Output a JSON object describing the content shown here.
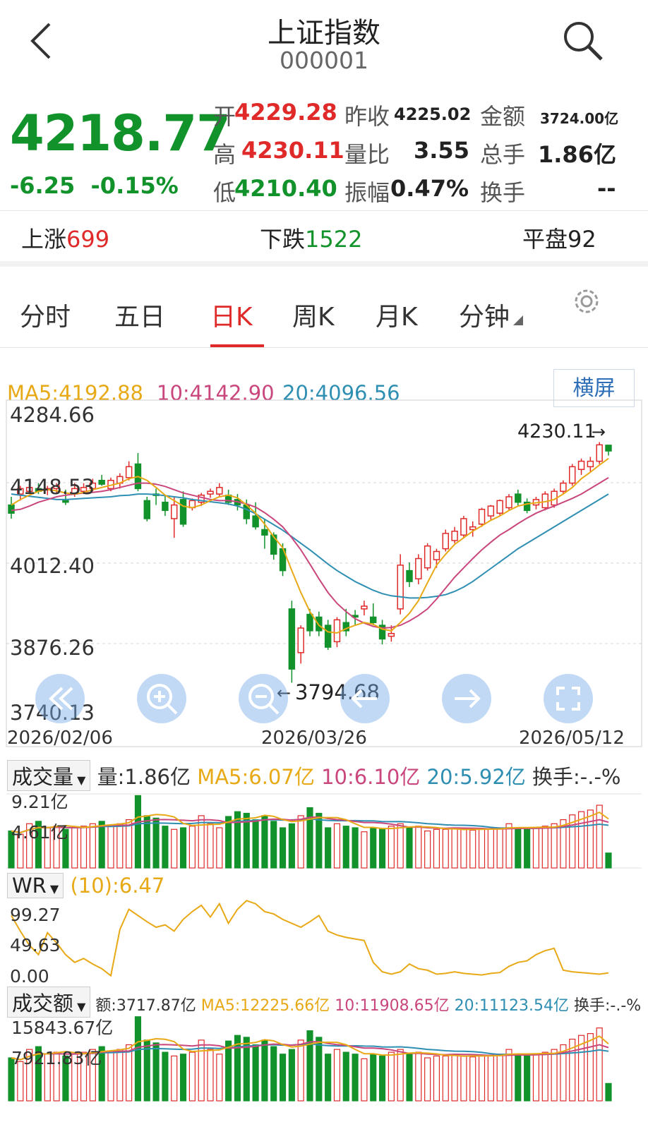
{
  "header": {
    "title": "上证指数",
    "code": "000001"
  },
  "quote": {
    "price": "4218.77",
    "change": "-6.25",
    "change_pct": "-0.15%",
    "open_label": "开",
    "open": "4229.28",
    "prev_close_label": "昨收",
    "prev_close": "4225.02",
    "amount_label": "金额",
    "amount": "3724.00亿",
    "high_label": "高",
    "high": "4230.11",
    "vol_ratio_label": "量比",
    "vol_ratio": "3.55",
    "total_vol_label": "总手",
    "total_vol": "1.86亿",
    "low_label": "低",
    "low": "4210.40",
    "amplitude_label": "振幅",
    "amplitude": "0.47%",
    "turnover_label": "换手",
    "turnover": "--"
  },
  "breadth": {
    "up_label": "上涨",
    "up": "699",
    "down_label": "下跌",
    "down": "1522",
    "flat_label": "平盘",
    "flat": "92"
  },
  "tabs": [
    "分时",
    "五日",
    "日K",
    "周K",
    "月K",
    "分钟"
  ],
  "active_tab": "日K",
  "ma": {
    "ma5": "MA5:4192.88",
    "ma10": "10:4142.90",
    "ma20": "20:4096.56"
  },
  "landscape_label": "横屏",
  "price_axis": [
    "4284.66",
    "4148.53",
    "4012.40",
    "3876.26",
    "3740.13"
  ],
  "annotations": {
    "high_mark": "4230.11",
    "low_mark": "3794.68"
  },
  "dates": [
    "2026/02/06",
    "2026/03/26",
    "2026/05/12"
  ],
  "volume": {
    "selector": "成交量",
    "value": "量:1.86亿",
    "ma5": "MA5:6.07亿",
    "ma10": "10:6.10亿",
    "ma20": "20:5.92亿",
    "turnover": "换手:-.-%",
    "axis": [
      "9.21亿",
      "4.61亿"
    ]
  },
  "wr": {
    "selector": "WR",
    "value": "(10):6.47",
    "axis": [
      "99.27",
      "49.63",
      "0.00"
    ]
  },
  "amount_panel": {
    "selector": "成交额",
    "value": "额:3717.87亿",
    "ma5": "MA5:12225.66亿",
    "ma10": "10:11908.65亿",
    "ma20": "20:11123.54亿",
    "turnover": "换手:-.-%",
    "axis": [
      "15843.67亿",
      "7921.83亿"
    ]
  },
  "colors": {
    "up": "#e02a2a",
    "down": "#12922a",
    "ma5": "#e8a916",
    "ma10": "#c9477c",
    "ma20": "#2f8fb3"
  },
  "chart_data": {
    "type": "candlestick",
    "ylim": [
      3740.13,
      4284.66
    ],
    "x_labels": [
      "2026/02/06",
      "2026/03/26",
      "2026/05/12"
    ],
    "candles_ohlc": [
      [
        4120,
        4135,
        4095,
        4105
      ],
      [
        4140,
        4155,
        4128,
        4150
      ],
      [
        4145,
        4158,
        4140,
        4152
      ],
      [
        4150,
        4160,
        4140,
        4145
      ],
      [
        4148,
        4155,
        4138,
        4150
      ],
      [
        4150,
        4160,
        4142,
        4155
      ],
      [
        4128,
        4148,
        4120,
        4125
      ],
      [
        4140,
        4160,
        4135,
        4150
      ],
      [
        4145,
        4160,
        4140,
        4152
      ],
      [
        4150,
        4168,
        4145,
        4160
      ],
      [
        4165,
        4175,
        4155,
        4158
      ],
      [
        4150,
        4170,
        4145,
        4165
      ],
      [
        4160,
        4178,
        4150,
        4172
      ],
      [
        4170,
        4200,
        4165,
        4190
      ],
      [
        4195,
        4215,
        4145,
        4150
      ],
      [
        4128,
        4135,
        4090,
        4095
      ],
      [
        4140,
        4150,
        4120,
        4138
      ],
      [
        4125,
        4138,
        4100,
        4110
      ],
      [
        4095,
        4135,
        4060,
        4120
      ],
      [
        4130,
        4145,
        4080,
        4085
      ],
      [
        4115,
        4132,
        4110,
        4128
      ],
      [
        4125,
        4142,
        4118,
        4138
      ],
      [
        4140,
        4150,
        4133,
        4145
      ],
      [
        4140,
        4160,
        4135,
        4152
      ],
      [
        4138,
        4148,
        4120,
        4125
      ],
      [
        4130,
        4140,
        4110,
        4120
      ],
      [
        4120,
        4130,
        4085,
        4095
      ],
      [
        4100,
        4125,
        4075,
        4080
      ],
      [
        4075,
        4095,
        4040,
        4065
      ],
      [
        4065,
        4070,
        4020,
        4030
      ],
      [
        4040,
        4050,
        3990,
        4000
      ],
      [
        3930,
        3945,
        3795,
        3820
      ],
      [
        3850,
        3900,
        3830,
        3895
      ],
      [
        3920,
        3930,
        3880,
        3890
      ],
      [
        3915,
        3925,
        3880,
        3890
      ],
      [
        3900,
        3910,
        3855,
        3860
      ],
      [
        3870,
        3915,
        3860,
        3910
      ],
      [
        3905,
        3930,
        3880,
        3890
      ],
      [
        3918,
        3928,
        3900,
        3915
      ],
      [
        3930,
        3945,
        3918,
        3935
      ],
      [
        3915,
        3940,
        3900,
        3905
      ],
      [
        3900,
        3910,
        3865,
        3875
      ],
      [
        3880,
        3900,
        3870,
        3885
      ],
      [
        3930,
        4030,
        3920,
        4010
      ],
      [
        4000,
        4015,
        3970,
        3980
      ],
      [
        3985,
        4030,
        3975,
        4022
      ],
      [
        4005,
        4050,
        4000,
        4045
      ],
      [
        4020,
        4040,
        4005,
        4035
      ],
      [
        4040,
        4075,
        4035,
        4068
      ],
      [
        4055,
        4080,
        4050,
        4072
      ],
      [
        4065,
        4100,
        4060,
        4095
      ],
      [
        4075,
        4090,
        4062,
        4080
      ],
      [
        4085,
        4115,
        4080,
        4112
      ],
      [
        4100,
        4120,
        4092,
        4118
      ],
      [
        4105,
        4130,
        4100,
        4128
      ],
      [
        4115,
        4140,
        4110,
        4135
      ],
      [
        4140,
        4148,
        4118,
        4125
      ],
      [
        4125,
        4132,
        4105,
        4110
      ],
      [
        4120,
        4135,
        4112,
        4130
      ],
      [
        4115,
        4145,
        4110,
        4140
      ],
      [
        4120,
        4150,
        4115,
        4145
      ],
      [
        4145,
        4165,
        4140,
        4160
      ],
      [
        4160,
        4195,
        4155,
        4190
      ],
      [
        4185,
        4205,
        4175,
        4200
      ],
      [
        4190,
        4208,
        4180,
        4200
      ],
      [
        4200,
        4235,
        4195,
        4230
      ],
      [
        4229.28,
        4230.11,
        4210.4,
        4218.77
      ]
    ],
    "ma5": [
      4120,
      4130,
      4138,
      4145,
      4148,
      4146,
      4142,
      4140,
      4143,
      4148,
      4152,
      4156,
      4160,
      4168,
      4172,
      4165,
      4152,
      4138,
      4128,
      4118,
      4115,
      4120,
      4128,
      4135,
      4138,
      4133,
      4120,
      4105,
      4085,
      4062,
      4042,
      4000,
      3960,
      3925,
      3900,
      3888,
      3886,
      3894,
      3900,
      3905,
      3902,
      3893,
      3890,
      3905,
      3922,
      3945,
      3978,
      4010,
      4030,
      4048,
      4060,
      4072,
      4082,
      4092,
      4100,
      4110,
      4118,
      4122,
      4124,
      4126,
      4130,
      4140,
      4152,
      4168,
      4180,
      4193,
      4205
    ],
    "ma10": [
      4110,
      4112,
      4118,
      4125,
      4130,
      4135,
      4138,
      4140,
      4142,
      4143,
      4145,
      4148,
      4152,
      4156,
      4160,
      4160,
      4158,
      4154,
      4148,
      4142,
      4138,
      4134,
      4130,
      4128,
      4128,
      4126,
      4122,
      4116,
      4106,
      4094,
      4080,
      4060,
      4038,
      4012,
      3985,
      3960,
      3940,
      3925,
      3912,
      3904,
      3898,
      3895,
      3896,
      3900,
      3908,
      3918,
      3930,
      3948,
      3968,
      3988,
      4005,
      4022,
      4038,
      4052,
      4065,
      4075,
      4086,
      4096,
      4105,
      4112,
      4118,
      4125,
      4132,
      4140,
      4150,
      4160,
      4170
    ],
    "ma20": [
      4140,
      4138,
      4136,
      4134,
      4132,
      4130,
      4130,
      4131,
      4132,
      4133,
      4134,
      4135,
      4137,
      4138,
      4140,
      4140,
      4139,
      4137,
      4135,
      4133,
      4130,
      4128,
      4126,
      4124,
      4122,
      4118,
      4112,
      4104,
      4094,
      4084,
      4074,
      4062,
      4050,
      4038,
      4025,
      4012,
      4000,
      3990,
      3980,
      3972,
      3964,
      3958,
      3954,
      3952,
      3950,
      3950,
      3951,
      3953,
      3956,
      3962,
      3970,
      3980,
      3992,
      4004,
      4016,
      4028,
      4040,
      4050,
      4060,
      4070,
      4080,
      4090,
      4100,
      4110,
      4120,
      4130,
      4140
    ],
    "volume_ylim": [
      0,
      9.21
    ],
    "volume": [
      4.6,
      4.2,
      5.5,
      5.8,
      5.0,
      5.2,
      4.8,
      5.0,
      5.2,
      5.5,
      5.8,
      5.3,
      5.5,
      6.0,
      9.0,
      6.5,
      6.2,
      5.2,
      4.8,
      5.0,
      5.2,
      6.5,
      5.5,
      5.0,
      6.4,
      7.0,
      6.8,
      6.0,
      6.5,
      5.8,
      5.0,
      5.5,
      6.5,
      7.5,
      6.8,
      5.0,
      5.5,
      5.2,
      5.0,
      4.5,
      5.0,
      4.8,
      5.2,
      5.5,
      5.0,
      5.2,
      4.6,
      4.8,
      4.8,
      4.9,
      4.8,
      4.7,
      4.8,
      4.9,
      5.0,
      5.5,
      4.9,
      4.8,
      5.0,
      5.2,
      5.5,
      6.0,
      6.6,
      7.0,
      7.2,
      7.8,
      1.86
    ],
    "wr": [
      80,
      60,
      42,
      30,
      58,
      45,
      30,
      20,
      25,
      18,
      12,
      3,
      62,
      88,
      80,
      72,
      65,
      68,
      60,
      75,
      85,
      93,
      78,
      95,
      70,
      88,
      99,
      95,
      85,
      82,
      75,
      70,
      65,
      72,
      80,
      60,
      55,
      52,
      50,
      48,
      20,
      8,
      5,
      8,
      18,
      12,
      10,
      5,
      6,
      8,
      6,
      5,
      4,
      6,
      7,
      15,
      20,
      22,
      30,
      35,
      38,
      10,
      8,
      7,
      6,
      5,
      6.47
    ]
  }
}
